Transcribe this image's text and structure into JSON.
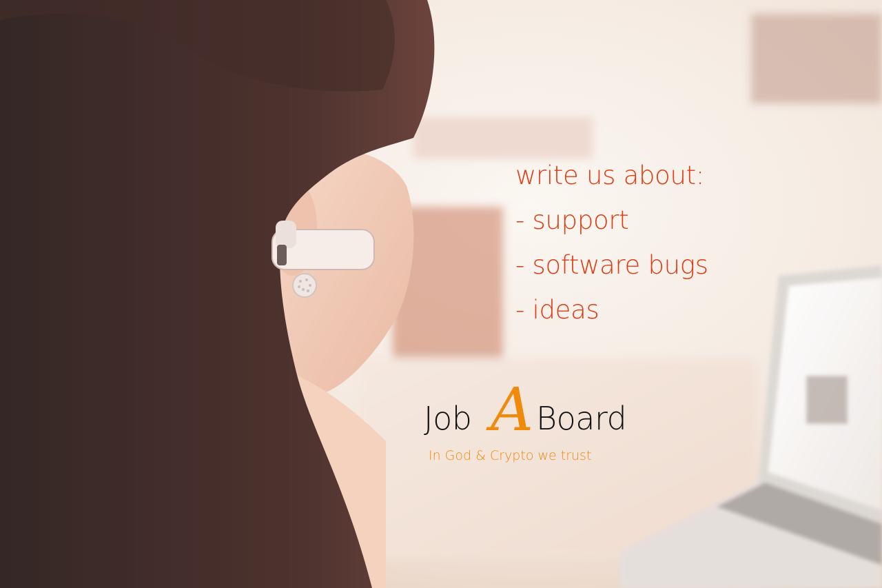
{
  "photo": {
    "subject": "photo-woman-with-headset",
    "colors": {
      "hair": "#2a1512",
      "skin": "#f0c6ad",
      "background": "#f3ebe3",
      "accent_warm": "#c46b4a"
    }
  },
  "pitch": {
    "heading": "write us about:",
    "items": [
      "- support",
      "- software bugs",
      "- ideas"
    ],
    "color": "#e23a12"
  },
  "brand": {
    "logo_part1": "Job",
    "logo_letter": "A",
    "logo_part2": "Board",
    "tagline": "In God & Crypto we trust",
    "letter_color": "#f08a0c",
    "text_color": "#111111"
  }
}
